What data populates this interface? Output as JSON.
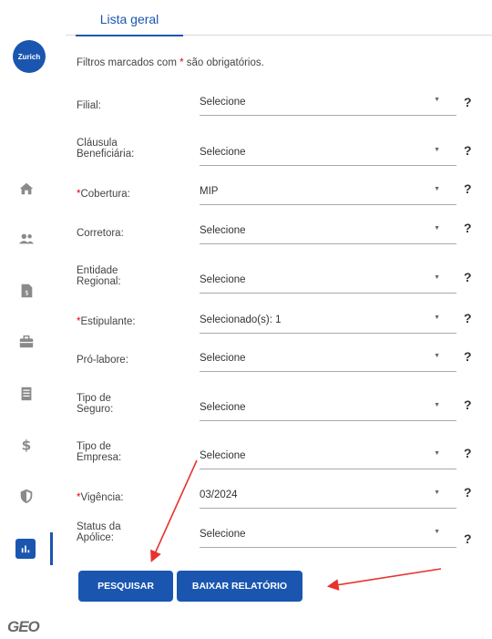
{
  "brand": {
    "logo_text": "Zurich",
    "footer_logo": "GEO"
  },
  "tabs": [
    {
      "label": "Lista geral"
    }
  ],
  "note": {
    "prefix": "Filtros marcados com ",
    "star": "*",
    "suffix": " são obrigatórios."
  },
  "filters": [
    {
      "label": "Filial:",
      "required": false,
      "value": "Selecione"
    },
    {
      "label_line1": "Cláusula",
      "label_line2": "Beneficiária:",
      "required": false,
      "value": "Selecione"
    },
    {
      "label": "Cobertura:",
      "required": true,
      "value": "MIP"
    },
    {
      "label": "Corretora:",
      "required": false,
      "value": "Selecione"
    },
    {
      "label_line1": "Entidade",
      "label_line2": "Regional:",
      "required": false,
      "value": "Selecione"
    },
    {
      "label": "Estipulante:",
      "required": true,
      "value": "Selecionado(s): 1"
    },
    {
      "label": "Pró-labore:",
      "required": false,
      "value": "Selecione"
    },
    {
      "label_line1": "Tipo de",
      "label_line2": "Seguro:",
      "required": false,
      "value": "Selecione"
    },
    {
      "label_line1": "Tipo de",
      "label_line2": "Empresa:",
      "required": false,
      "value": "Selecione"
    },
    {
      "label": "Vigência:",
      "required": true,
      "value": "03/2024"
    },
    {
      "label_line1": "Status da",
      "label_line2": "Apólice:",
      "required": false,
      "value": "Selecione"
    }
  ],
  "help_glyph": "?",
  "required_star": "*",
  "dropdown_glyph": "▼",
  "buttons": {
    "search": "PESQUISAR",
    "report": "BAIXAR RELATÓRIO"
  },
  "sidebar_icons": [
    "home-icon",
    "users-icon",
    "document-icon",
    "briefcase-icon",
    "receipt-icon",
    "dollar-icon",
    "shield-icon",
    "chart-icon"
  ],
  "colors": {
    "primary": "#1a56b0",
    "required": "#e0001a",
    "annotation_arrow": "#e8322e"
  }
}
